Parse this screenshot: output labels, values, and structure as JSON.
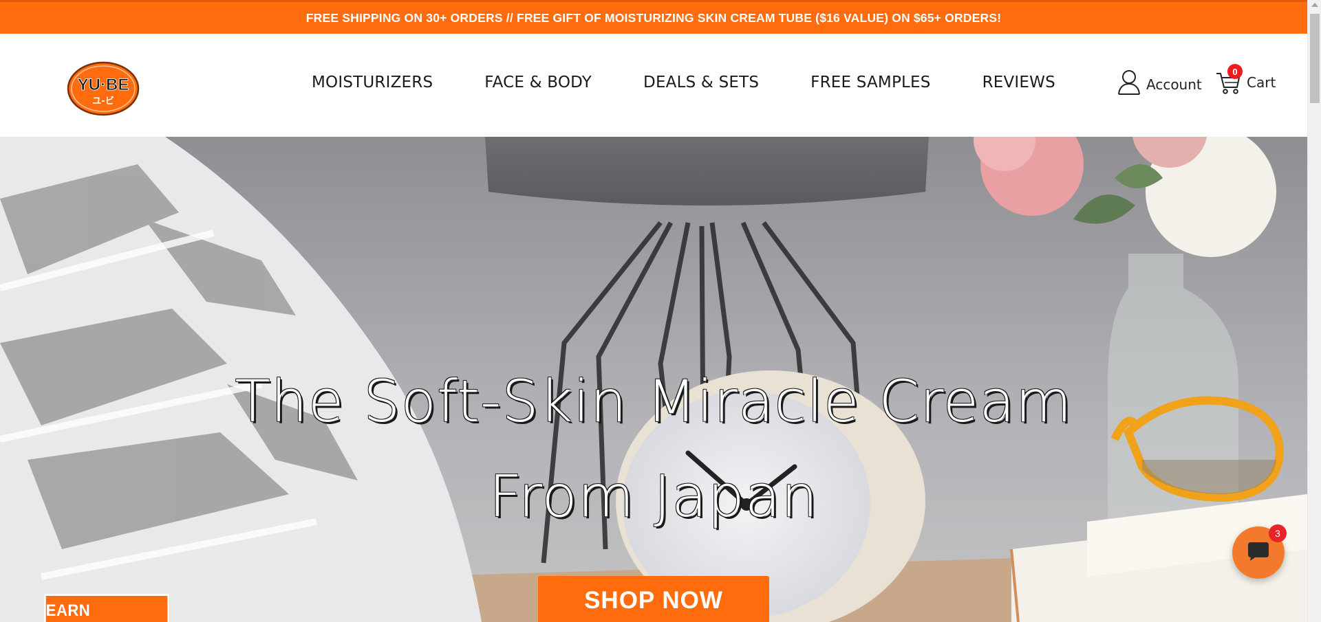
{
  "announcement": {
    "text": "FREE SHIPPING ON 30+ ORDERS // FREE GIFT OF MOISTURIZING SKIN CREAM TUBE ($16 VALUE) ON $65+ ORDERS!"
  },
  "logo": {
    "text": "YU·BE",
    "subtext": "ユ-ビ"
  },
  "nav": {
    "items": [
      {
        "label": "MOISTURIZERS"
      },
      {
        "label": "FACE & BODY"
      },
      {
        "label": "DEALS & SETS"
      },
      {
        "label": "FREE SAMPLES"
      },
      {
        "label": "REVIEWS"
      }
    ]
  },
  "header": {
    "account_label": "Account",
    "cart_label": "Cart",
    "cart_count": "0"
  },
  "hero": {
    "headline_line1": "The Soft-Skin Miracle Cream",
    "headline_line2": "From Japan",
    "cta": "SHOP NOW"
  },
  "rewards": {
    "label": "EARN REWARDS"
  },
  "chat": {
    "badge": "3"
  },
  "colors": {
    "brand_orange": "#ff6c0e",
    "badge_red": "#ee1c1c"
  },
  "icons": [
    "user-icon",
    "cart-icon",
    "chat-icon"
  ]
}
